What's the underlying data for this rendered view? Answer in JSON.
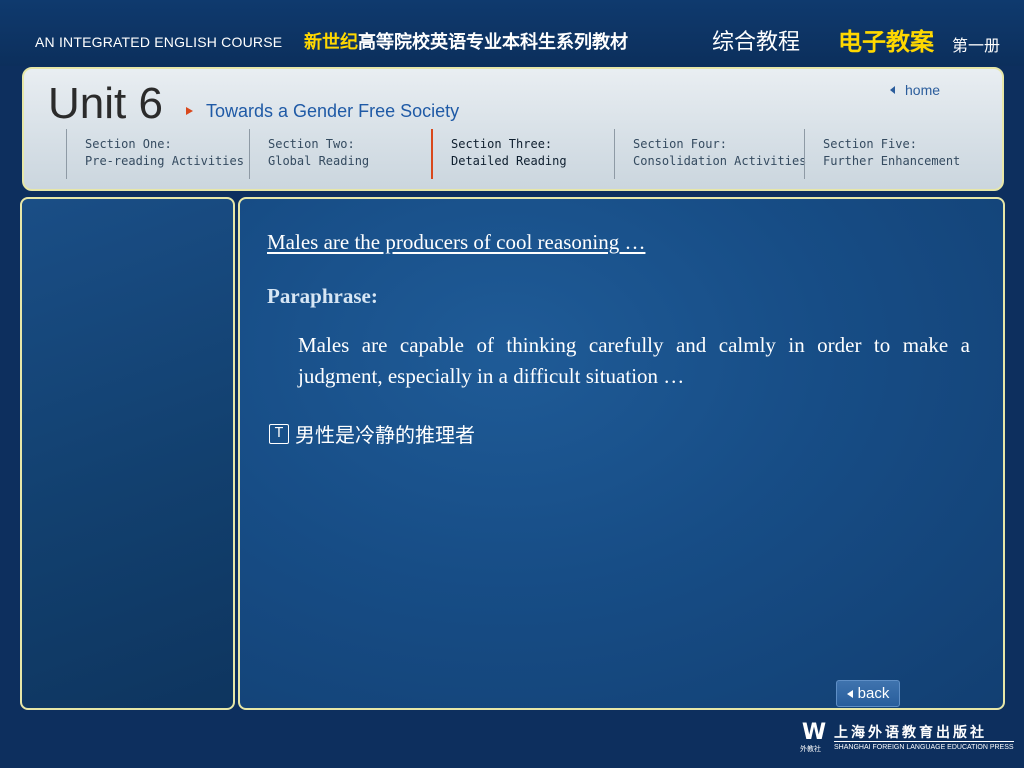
{
  "banner": {
    "course_title": "AN INTEGRATED ENGLISH COURSE",
    "series_highlight": "新世纪",
    "series_rest": "高等院校英语专业本科生系列教材",
    "book_name": "综合教程",
    "lesson_plan": "电子教案",
    "volume": "第一册"
  },
  "header": {
    "unit": "Unit 6",
    "subtitle": "Towards a Gender Free Society",
    "home_label": "home"
  },
  "sections": [
    {
      "line1": "Section One:",
      "line2": "Pre-reading Activities",
      "active": false
    },
    {
      "line1": "Section Two:",
      "line2": "Global Reading",
      "active": false
    },
    {
      "line1": "Section Three:",
      "line2": "Detailed Reading",
      "active": true
    },
    {
      "line1": "Section Four:",
      "line2": "Consolidation Activities",
      "active": false
    },
    {
      "line1": "Section Five:",
      "line2": "Further Enhancement",
      "active": false
    }
  ],
  "main": {
    "headline": "Males are the producers of cool reasoning …",
    "paraphrase_label": "Paraphrase:",
    "paraphrase_text": "Males are capable of thinking carefully and calmly in order to make a judgment, especially in a difficult situation …",
    "translation_icon_letter": "T",
    "translation_text": "男性是冷静的推理者",
    "back_label": "back"
  },
  "publisher": {
    "logo_letter": "W",
    "logo_caption": "外教社",
    "name_zh": "上海外语教育出版社",
    "name_en": "SHANGHAI FOREIGN LANGUAGE EDUCATION PRESS"
  },
  "colors": {
    "page_background": "#0d2f5e",
    "panel_border": "#e7e7a8",
    "accent_orange": "#d9481c",
    "banner_yellow": "#ffd800",
    "subtitle_blue": "#1f5aa6"
  }
}
